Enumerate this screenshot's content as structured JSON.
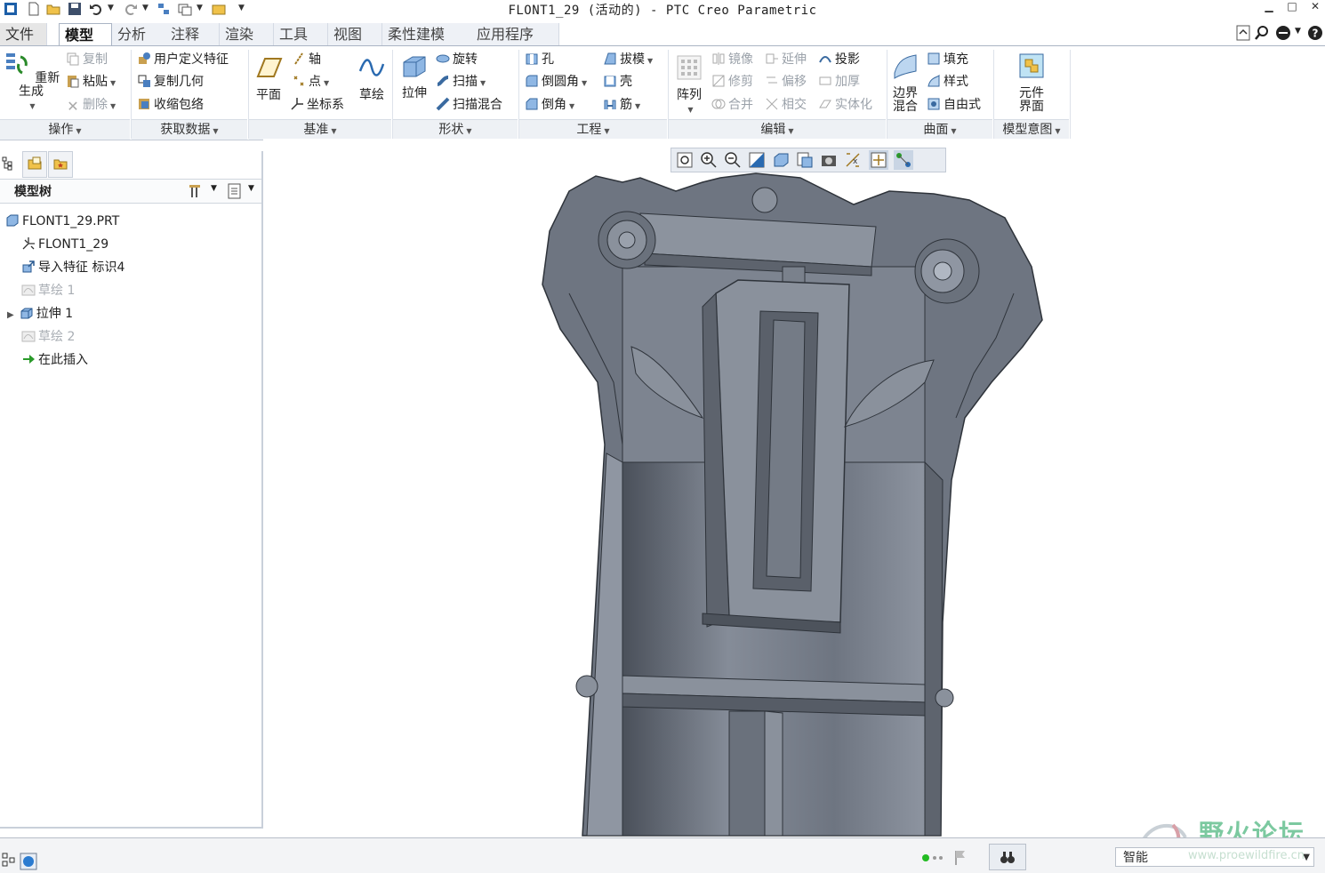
{
  "window": {
    "title": "FLONT1_29 (活动的) - PTC Creo Parametric"
  },
  "tabs": [
    {
      "label": "文件"
    },
    {
      "label": "模型"
    },
    {
      "label": "分析"
    },
    {
      "label": "注释"
    },
    {
      "label": "渲染"
    },
    {
      "label": "工具"
    },
    {
      "label": "视图"
    },
    {
      "label": "柔性建模"
    },
    {
      "label": "应用程序"
    }
  ],
  "ribbon": {
    "operations": {
      "regenerate": "重新生成",
      "copy": "复制",
      "paste": "粘贴",
      "delete": "删除",
      "group": "操作"
    },
    "get_data": {
      "udf": "用户定义特征",
      "copy_geom": "复制几何",
      "shrinkwrap": "收缩包络",
      "group": "获取数据"
    },
    "datum": {
      "plane": "平面",
      "axis": "轴",
      "point": "点",
      "csys": "坐标系",
      "sketch": "草绘",
      "group": "基准"
    },
    "shapes": {
      "extrude": "拉伸",
      "revolve": "旋转",
      "sweep": "扫描",
      "swept_blend": "扫描混合",
      "group": "形状"
    },
    "engineering": {
      "hole": "孔",
      "round": "倒圆角",
      "chamfer": "倒角",
      "draft": "拔模",
      "shell": "壳",
      "rib": "筋",
      "group": "工程"
    },
    "editing": {
      "pattern": "阵列",
      "mirror": "镜像",
      "trim": "修剪",
      "merge": "合并",
      "extend": "延伸",
      "offset": "偏移",
      "intersect": "相交",
      "project": "投影",
      "thicken": "加厚",
      "solidify": "实体化",
      "group": "编辑"
    },
    "surfaces": {
      "boundary_l1": "边界",
      "boundary_l2": "混合",
      "fill": "填充",
      "style": "样式",
      "freestyle": "自由式",
      "group": "曲面"
    },
    "model_intent": {
      "component_l1": "元件",
      "component_l2": "界面",
      "group": "模型意图"
    }
  },
  "model_tree": {
    "title": "模型树",
    "items": [
      {
        "label": "FLONT1_29.PRT",
        "dim": false
      },
      {
        "label": "FLONT1_29",
        "dim": false
      },
      {
        "label": "导入特征 标识4",
        "dim": false
      },
      {
        "label": "草绘 1",
        "dim": true
      },
      {
        "label": "拉伸 1",
        "dim": false
      },
      {
        "label": "草绘 2",
        "dim": true
      },
      {
        "label": "在此插入",
        "dim": false
      }
    ]
  },
  "statusbar": {
    "filter": "智能"
  },
  "watermark": {
    "text": "野火论坛",
    "url": "www.proewildfire.cn"
  },
  "colors": {
    "model": "#6f7683",
    "accent_blue": "#2b7bd0",
    "insert_green": "#2a9a2a",
    "status_green": "#22bb22"
  }
}
